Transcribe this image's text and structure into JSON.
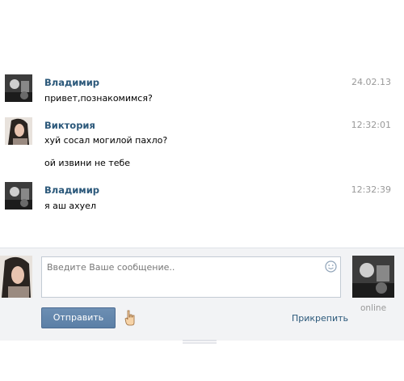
{
  "messages": [
    {
      "author": "Владимир",
      "time": "24.02.13",
      "lines": [
        "привет,познакомимся?"
      ]
    },
    {
      "author": "Виктория",
      "time": "12:32:01",
      "lines": [
        "хуй сосал могилой пахло?",
        "ой извини не тебе"
      ]
    },
    {
      "author": "Владимир",
      "time": "12:32:39",
      "lines": [
        "я аш ахуел"
      ]
    }
  ],
  "composer": {
    "placeholder": "Введите Ваше сообщение..",
    "send_label": "Отправить",
    "attach_label": "Прикрепить",
    "status": "online"
  },
  "colors": {
    "name": "#2b587a",
    "time": "#999999",
    "button": "#5b7fa6",
    "composer_bg": "#f2f3f5"
  }
}
